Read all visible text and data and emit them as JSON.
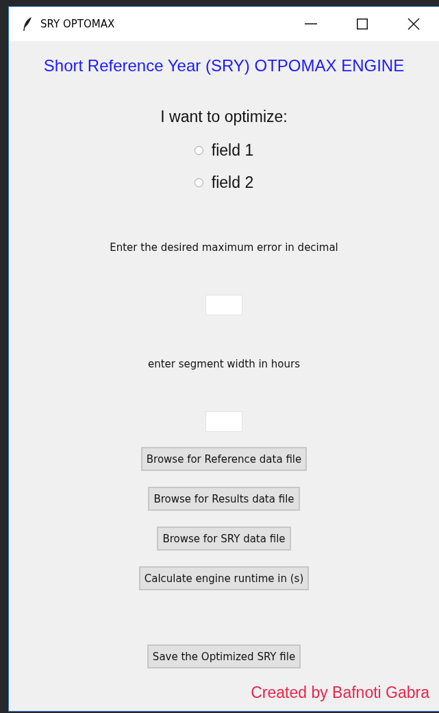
{
  "window": {
    "title": "SRY OPTOMAX"
  },
  "heading": "Short Reference Year (SRY) OTPOMAX ENGINE",
  "prompt": "I want to optimize:",
  "options": [
    {
      "label": "field 1",
      "selected": false
    },
    {
      "label": "field 2",
      "selected": false
    }
  ],
  "inputs": [
    {
      "label": "Enter the desired maximum error in decimal"
    },
    {
      "label": "enter segment width in hours"
    }
  ],
  "buttons": [
    "Browse for Reference data file",
    "Browse for Results data file",
    "Browse for SRY data file",
    "Calculate engine runtime in (s)"
  ],
  "save_button": "Save the Optimized SRY file",
  "credit": "Created by Bafnoti Gabra"
}
